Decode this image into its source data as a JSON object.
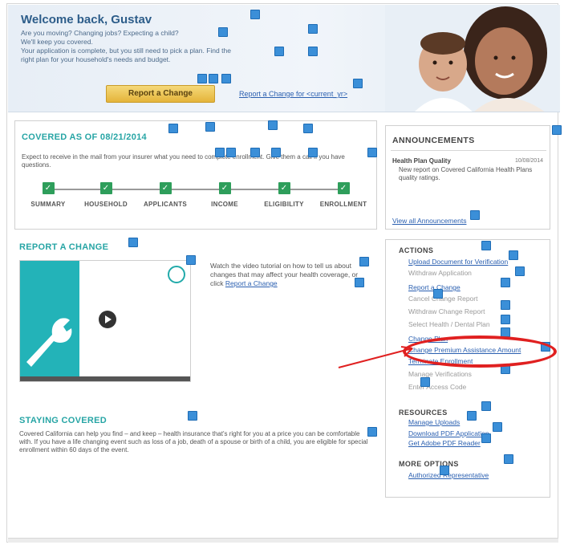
{
  "hero": {
    "title": "Welcome back, Gustav",
    "text_lines": [
      "Are you moving? Changing jobs? Expecting a child?",
      "We'll keep you covered.",
      "Your application is complete, but you still need to pick a plan. Find the",
      "right plan for your household's needs and budget."
    ],
    "button_label": "Report a Change",
    "link_label": "Report a Change for <current_yr>"
  },
  "covered": {
    "title": "COVERED AS OF 08/21/2014",
    "description": "Expect to receive in the mail from your insurer what you need to complete enrollment. Give them a call if you have questions.",
    "steps": [
      "SUMMARY",
      "HOUSEHOLD",
      "APPLICANTS",
      "INCOME",
      "ELIGIBILITY",
      "ENROLLMENT"
    ]
  },
  "announcements": {
    "title": "ANNOUNCEMENTS",
    "item_title": "Health Plan Quality",
    "item_date": "10/08/2014",
    "item_body": "New report on Covered California Health Plans quality ratings.",
    "view_all": "View all Announcements"
  },
  "report_change": {
    "title": "REPORT A CHANGE",
    "video_text": "Watch the video tutorial on how to tell us about changes that may affect your health coverage, or click",
    "video_link": "Report a Change"
  },
  "staying": {
    "title": "STAYING COVERED",
    "text": "Covered California can help you find – and keep – health insurance that's right for you at a price you can be comfortable with. If you have a life changing event such as loss of a job, death of a spouse or birth of a child, you are eligible for special enrollment within 60 days of the event."
  },
  "actions": {
    "title": "ACTIONS",
    "items": [
      {
        "label": "Upload Document for Verification",
        "enabled": true
      },
      {
        "label": "Withdraw Application",
        "enabled": false
      },
      {
        "label": "Report a Change",
        "enabled": true
      },
      {
        "label": "Cancel Change Report",
        "enabled": false
      },
      {
        "label": "Withdraw Change Report",
        "enabled": false
      },
      {
        "label": "Select Health / Dental Plan",
        "enabled": false
      },
      {
        "label": "Change Plan",
        "enabled": true
      },
      {
        "label": "Change Premium Assistance Amount",
        "enabled": true
      },
      {
        "label": "Terminate Enrollment",
        "enabled": true
      },
      {
        "label": "Manage Verifications",
        "enabled": false
      },
      {
        "label": "Enter Access Code",
        "enabled": false
      }
    ],
    "resources_title": "RESOURCES",
    "resources": [
      "Manage Uploads",
      "Download PDF Application",
      "Get Adobe PDF Reader"
    ],
    "more_title": "MORE OPTIONS",
    "more": [
      "Authorized Representative"
    ]
  },
  "colors": {
    "teal_heading": "#27a5a5",
    "link": "#2a5fb0",
    "step_check": "#2e9e5b",
    "highlight": "#e02020",
    "button": "#e4b43a"
  }
}
